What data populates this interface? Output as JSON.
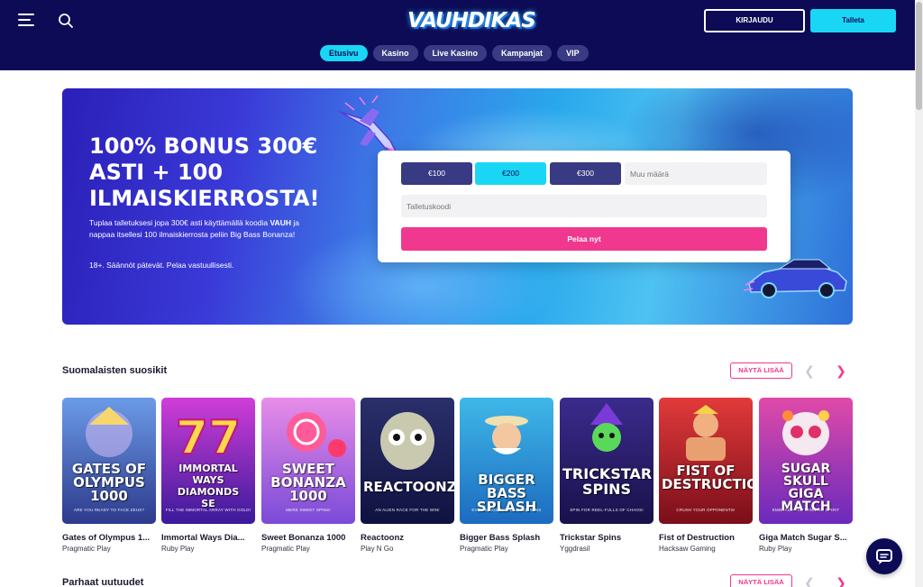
{
  "header": {
    "logo_text": "VAUHDIKAS",
    "login_label": "KIRJAUDU",
    "deposit_label": "Talleta",
    "nav": [
      {
        "label": "Etusivu",
        "active": true
      },
      {
        "label": "Kasino",
        "active": false
      },
      {
        "label": "Live Kasino",
        "active": false
      },
      {
        "label": "Kampanjat",
        "active": false
      },
      {
        "label": "VIP",
        "active": false
      }
    ]
  },
  "hero": {
    "title": "100% BONUS 300€ ASTI + 100 ILMAISKIERROSTA!",
    "desc_pre": "Tuplaa talletuksesi jopa 300€ asti käyttämällä koodia",
    "desc_code": "VAUH",
    "desc_post": "ja nappaa itsellesi 100 ilmaiskierrosta peliin Big Bass Bonanza!",
    "note": "18+. Säännöt pätevät. Pelaa vastuullisesti.",
    "form": {
      "amounts": [
        "€100",
        "€200",
        "€300"
      ],
      "selected_amount": "€200",
      "other_amount_placeholder": "Muu määrä",
      "code_placeholder": "Talletuskoodi",
      "play_label": "Pelaa nyt"
    }
  },
  "sections": [
    {
      "title": "Suomalaisten suosikit",
      "show_more": "NÄYTÄ LISÄÄ"
    },
    {
      "title": "Parhaat uutuudet",
      "show_more": "NÄYTÄ LISÄÄ"
    }
  ],
  "games": [
    {
      "name": "Gates of Olympus 1...",
      "provider": "Pragmatic Play",
      "logo": "GATES OF\nOLYMPUS\n1000",
      "tag": "ARE YOU READY TO FACE ZEUS?",
      "colors": [
        "#6b9be8",
        "#2d3a8c"
      ]
    },
    {
      "name": "Immortal Ways Dia...",
      "provider": "Ruby Play",
      "logo": "IMMORTAL WAYS\nDIAMONDS\nSE",
      "tag": "FILL THE IMMORTAL ARRAY WITH GOLD!",
      "colors": [
        "#d03dd8",
        "#3a1a9a"
      ]
    },
    {
      "name": "Sweet Bonanza 1000",
      "provider": "Pragmatic Play",
      "logo": "SWEET\nBONANZA\n1000",
      "tag": "MERE SWEET SPINS!",
      "colors": [
        "#e88de8",
        "#7a4ad8"
      ]
    },
    {
      "name": "Reactoonz",
      "provider": "Play N Go",
      "logo": "REACTOONZ",
      "tag": "AN ALIEN RACE FOR THE WIN!",
      "colors": [
        "#2a2f6a",
        "#0f1240"
      ]
    },
    {
      "name": "Bigger Bass Splash",
      "provider": "Pragmatic Play",
      "logo": "BIGGER\nBASS SPLASH",
      "tag": "EVEN BIGGER, SPLASHIER WINS",
      "colors": [
        "#3fb8e8",
        "#1c6bc0"
      ]
    },
    {
      "name": "Trickstar Spins",
      "provider": "Yggdrasil",
      "logo": "TRICKSTAR\nSPINS",
      "tag": "SPIN FOR REEL-FULLS OF CHAOS!",
      "colors": [
        "#3b2b8c",
        "#18114a"
      ]
    },
    {
      "name": "Fist of Destruction",
      "provider": "Hacksaw Gaming",
      "logo": "FIST OF\nDESTRUCTION",
      "tag": "CRUSH YOUR OPPONENTS!",
      "colors": [
        "#e23a3a",
        "#7a0e1a"
      ]
    },
    {
      "name": "Giga Match Sugar S...",
      "provider": "Ruby Play",
      "logo": "SUGAR\nSKULL\nGIGA MATCH",
      "tag": "EMBRACE THE WINNING SPIRIT",
      "colors": [
        "#e04aa8",
        "#6a2abd"
      ]
    }
  ],
  "colors": {
    "header_bg": "#0d0b55",
    "accent_cyan": "#19d6f5",
    "accent_pink": "#f0388e",
    "tab_bg": "#383a83"
  },
  "icons": [
    "menu-icon",
    "search-icon",
    "chevron-left-icon",
    "chevron-right-icon",
    "chat-icon"
  ]
}
